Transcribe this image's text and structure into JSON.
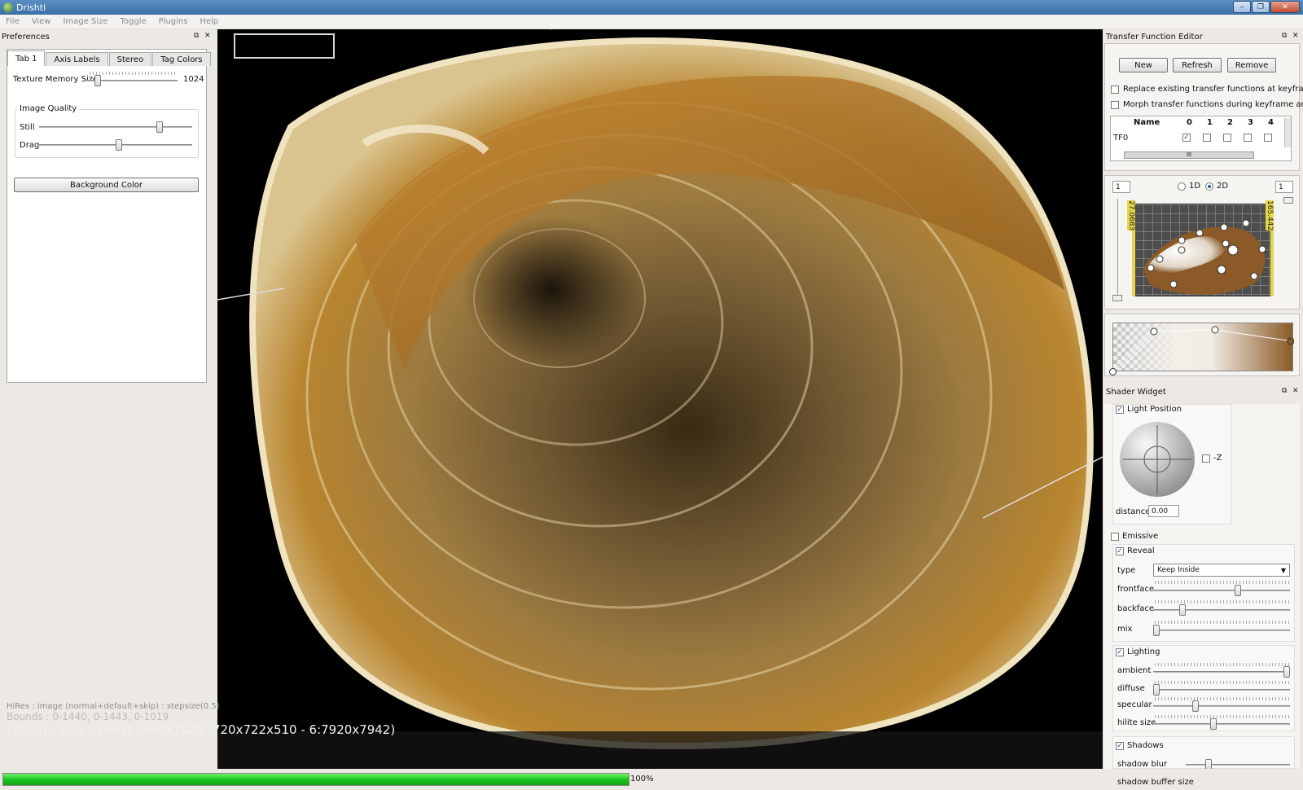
{
  "window": {
    "title": "Drishti"
  },
  "menu": [
    "File",
    "View",
    "Image Size",
    "Toggle",
    "Plugins",
    "Help"
  ],
  "preferences": {
    "title": "Preferences",
    "tabs": [
      "Tab 1",
      "Axis Labels",
      "Stereo",
      "Tag Colors"
    ],
    "texture_memory_label": "Texture Memory Size",
    "texture_memory_value": "1024",
    "image_quality_title": "Image Quality",
    "still_label": "Still",
    "drag_label": "Drag",
    "background_color_button": "Background Color"
  },
  "viewer": {
    "info_line1": "HiRes : image (normal+default+skip) : stepsize(0.5)",
    "info_line2": "Bounds : 0-1440, 0-1443, 0-1019",
    "info_line3": "LoD(2) : Size : 1441x1444x1020 (720x722x510 - 6:7920x7942)"
  },
  "transfer_function_editor": {
    "title": "Transfer Function Editor",
    "buttons": [
      "New",
      "Refresh",
      "Remove"
    ],
    "replace_label": "Replace existing transfer functions at keyframes",
    "morph_label": "Morph transfer functions during keyframe animation",
    "table_headers": [
      "Name",
      "0",
      "1",
      "2",
      "3",
      "4"
    ],
    "table_row": {
      "name": "TF0",
      "checks": [
        true,
        false,
        false,
        false,
        false
      ]
    },
    "scroll_grip": "III",
    "left_spin": "1",
    "right_spin": "1",
    "mode_1d": "1D",
    "mode_2d": "2D",
    "left_bar_value": "27.0683",
    "right_bar_value": "165.442"
  },
  "shader_widget": {
    "title": "Shader Widget",
    "light_position_label": "Light Position",
    "neg_z_label": "-Z",
    "distance_label": "distance",
    "distance_value": "0.00",
    "emissive_label": "Emissive",
    "reveal_label": "Reveal",
    "type_label": "type",
    "type_value": "Keep Inside",
    "frontface_label": "frontface",
    "backface_label": "backface",
    "mix_label": "mix",
    "lighting_label": "Lighting",
    "ambient_label": "ambient",
    "diffuse_label": "diffuse",
    "specular_label": "specular",
    "hilite_label": "hilite size",
    "shadows_label": "Shadows",
    "shadow_blur_label": "shadow blur",
    "shadow_buffer_label": "shadow buffer size"
  },
  "status": {
    "progress_text": "100%",
    "progress": 1.0
  },
  "colors": {
    "accent": "#2b5ea8",
    "progress": "#17c11b",
    "volume": "#b9852f"
  }
}
